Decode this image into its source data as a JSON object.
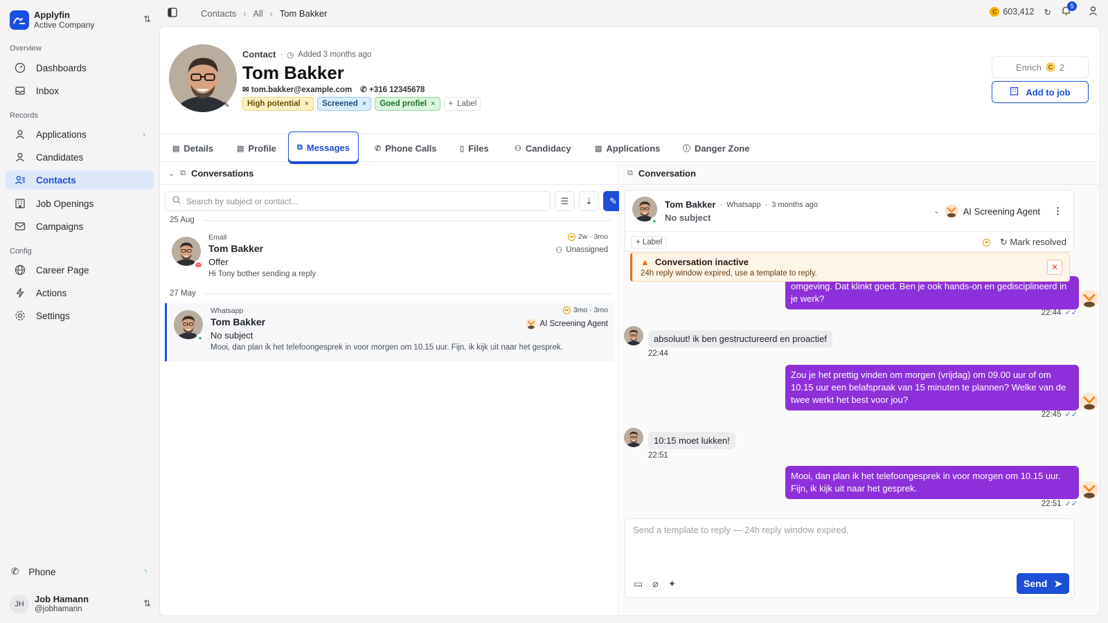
{
  "app": {
    "name": "Applyfin",
    "company": "Active Company"
  },
  "sidebar": {
    "sections": [
      "Overview",
      "Records",
      "Config"
    ],
    "overview": [
      {
        "label": "Dashboards",
        "icon": "gauge-icon"
      },
      {
        "label": "Inbox",
        "icon": "inbox-icon"
      }
    ],
    "records": [
      {
        "label": "Applications",
        "icon": "user-icon"
      },
      {
        "label": "Candidates",
        "icon": "user-icon"
      },
      {
        "label": "Contacts",
        "icon": "contacts-icon",
        "active": true
      },
      {
        "label": "Job Openings",
        "icon": "building-icon"
      },
      {
        "label": "Campaigns",
        "icon": "mail-check-icon"
      }
    ],
    "config": [
      {
        "label": "Career Page",
        "icon": "globe-icon"
      },
      {
        "label": "Actions",
        "icon": "bolt-icon"
      },
      {
        "label": "Settings",
        "icon": "gear-icon"
      }
    ],
    "phone": "Phone",
    "user": {
      "initials": "JH",
      "name": "Job Hamann",
      "handle": "@jobhamann"
    }
  },
  "breadcrumb": [
    "Contacts",
    "All",
    "Tom Bakker"
  ],
  "topbar": {
    "credits": "603,412",
    "notifications": "5"
  },
  "contact": {
    "kind": "Contact",
    "added": "Added 3 months ago",
    "name": "Tom Bakker",
    "email": "tom.bakker@example.com",
    "phone": "+316 12345678",
    "tags": [
      "High potential",
      "Screened",
      "Goed profiel"
    ],
    "add_label": "Label",
    "enrich_label": "Enrich",
    "enrich_cost": "2",
    "add_to_job": "Add to job"
  },
  "tabs": [
    "Details",
    "Profile",
    "Messages",
    "Phone Calls",
    "Files",
    "Candidacy",
    "Applications",
    "Danger Zone"
  ],
  "conversations": {
    "title": "Conversations",
    "search_placeholder": "Search by subject or contact...",
    "groups": [
      {
        "date": "25 Aug",
        "item": {
          "channel": "Email",
          "name": "Tom Bakker",
          "subject": "Offer",
          "preview": "Hi Tony bother sending a reply",
          "meta": "2w · 3mo",
          "assignee": "Unassigned"
        }
      },
      {
        "date": "27 May",
        "item": {
          "channel": "Whatsapp",
          "name": "Tom Bakker",
          "subject": "No subject",
          "preview": "Mooi, dan plan ik het telefoongesprek in voor morgen om 10.15 uur. Fijn, ik kijk uit naar het gesprek.",
          "meta": "3mo · 3mo",
          "assignee": "AI Screening Agent"
        }
      }
    ]
  },
  "conversation": {
    "title": "Conversation",
    "name": "Tom Bakker",
    "channel": "Whatsapp",
    "age": "3 months ago",
    "subject": "No subject",
    "agent": "AI Screening Agent",
    "label_btn": "Label",
    "resolve_btn": "Mark resolved",
    "warning_title": "Conversation inactive",
    "warning_text": "24h reply window expired, use a template to reply.",
    "messages": [
      {
        "dir": "out",
        "text": "omgeving. Dat klinkt goed. Ben je ook hands-on en gedisciplineerd in je werk?",
        "time": "22:44"
      },
      {
        "dir": "in",
        "text": "absoluut! ik ben gestructureerd en proactief",
        "time": "22:44"
      },
      {
        "dir": "out",
        "text": "Zou je het prettig vinden om morgen (vrijdag) om 09.00 uur of om 10.15 uur een belafspraak van 15 minuten te plannen? Welke van de twee werkt het best voor jou?",
        "time": "22:45"
      },
      {
        "dir": "in",
        "text": "10:15 moet lukken!",
        "time": "22:51"
      },
      {
        "dir": "out",
        "text": "Mooi, dan plan ik het telefoongesprek in voor morgen om 10.15 uur. Fijn, ik kijk uit naar het gesprek.",
        "time": "22:51"
      }
    ],
    "composer_placeholder": "Send a template to reply — 24h reply window expired.",
    "send": "Send"
  },
  "colors": {
    "accent": "#1c4fd6",
    "bubble_out": "#8d30d9",
    "warning": "#f06a1f"
  }
}
